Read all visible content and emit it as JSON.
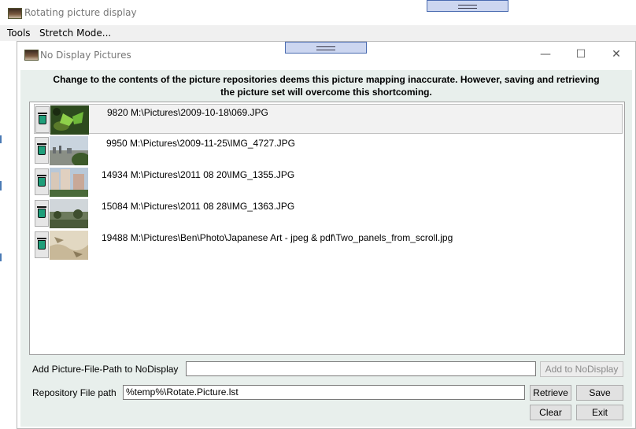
{
  "parent_window": {
    "title": "Rotating picture display",
    "menu": [
      "Tools",
      "Stretch Mode..."
    ]
  },
  "dialog": {
    "title": "No Display Pictures",
    "controls": {
      "minimize": "—",
      "maximize": "☐",
      "close": "✕"
    },
    "notice_line1": "Change to the contents of the picture repositories deems this picture mapping inaccurate.  However, saving and retrieving",
    "notice_line2": "the picture set will overcome this shortcoming.",
    "entries": [
      {
        "text": "9820 M:\\Pictures\\2009-10-18\\069.JPG",
        "thumb": "green-butterfly"
      },
      {
        "text": "9950 M:\\Pictures\\2009-11-25\\IMG_4727.JPG",
        "thumb": "city-skyline"
      },
      {
        "text": "14934 M:\\Pictures\\2011 08 20\\IMG_1355.JPG",
        "thumb": "buildings"
      },
      {
        "text": "15084 M:\\Pictures\\2011 08 28\\IMG_1363.JPG",
        "thumb": "landscape"
      },
      {
        "text": "19488 M:\\Pictures\\Ben\\Photo\\Japanese Art - jpeg & pdf\\Two_panels_from_scroll.jpg",
        "thumb": "scroll-art"
      }
    ],
    "add_path_label": "Add Picture-File-Path to NoDisplay",
    "add_path_value": "",
    "add_button": "Add to NoDisplay",
    "repo_label": "Repository File path",
    "repo_value": "%temp%\\Rotate.Picture.lst",
    "retrieve_button": "Retrieve",
    "save_button": "Save",
    "clear_button": "Clear",
    "exit_button": "Exit"
  },
  "colors": {
    "content_background": "#e8efec",
    "delete_icon": "#1f9e7a",
    "drag_handle": "#ccd6f0"
  }
}
